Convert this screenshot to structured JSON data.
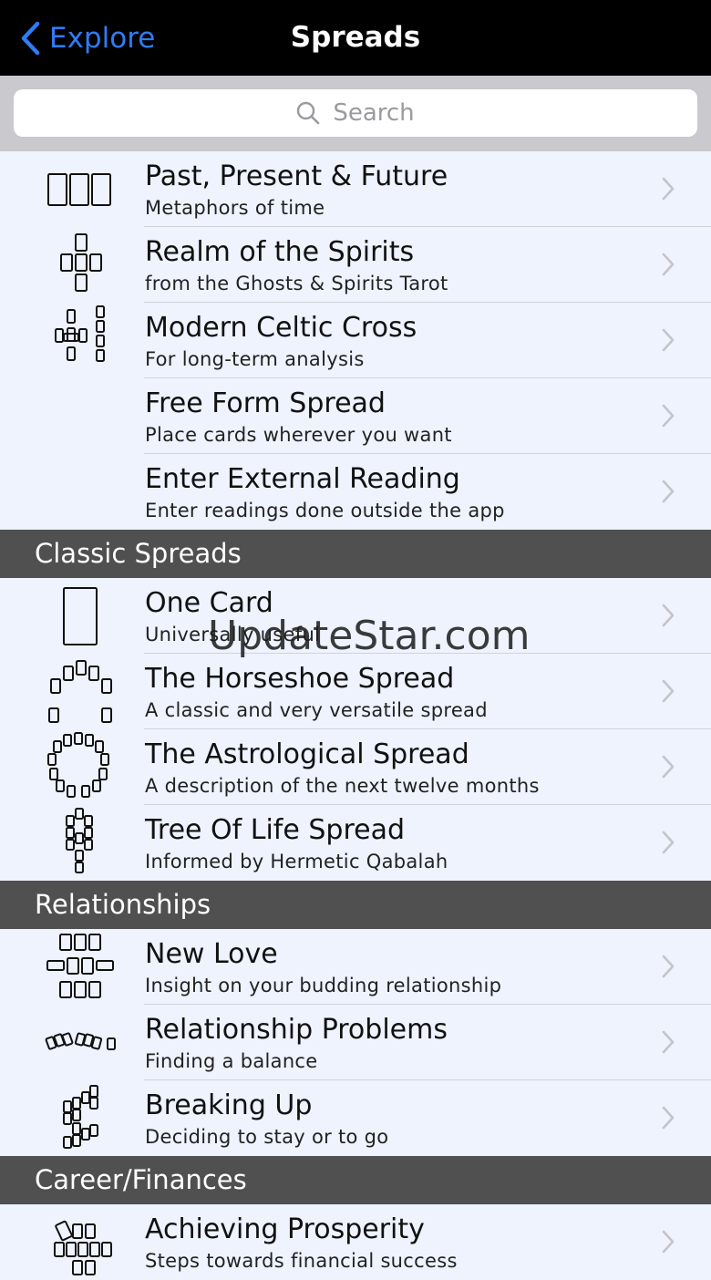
{
  "nav": {
    "back_label": "Explore",
    "title": "Spreads"
  },
  "search": {
    "placeholder": "Search"
  },
  "sections": [
    {
      "header": "",
      "rows": [
        {
          "title": "Past, Present & Future",
          "subtitle": "Metaphors of time",
          "icon": "three-card-spread-icon"
        },
        {
          "title": "Realm of the Spirits",
          "subtitle": "from the Ghosts & Spirits Tarot",
          "icon": "cross-spread-icon"
        },
        {
          "title": "Modern Celtic Cross",
          "subtitle": "For long-term analysis",
          "icon": "celtic-cross-icon"
        },
        {
          "title": "Free Form Spread",
          "subtitle": "Place cards wherever you want",
          "icon": ""
        },
        {
          "title": "Enter External Reading",
          "subtitle": "Enter readings done outside the app",
          "icon": ""
        }
      ]
    },
    {
      "header": "Classic Spreads",
      "rows": [
        {
          "title": "One Card",
          "subtitle": "Universally useful",
          "icon": "one-card-icon"
        },
        {
          "title": "The Horseshoe Spread",
          "subtitle": "A classic and very versatile spread",
          "icon": "horseshoe-spread-icon"
        },
        {
          "title": "The Astrological Spread",
          "subtitle": "A description of the next twelve months",
          "icon": "astrological-spread-icon"
        },
        {
          "title": "Tree Of Life Spread",
          "subtitle": "Informed by Hermetic Qabalah",
          "icon": "tree-of-life-icon"
        }
      ]
    },
    {
      "header": "Relationships",
      "rows": [
        {
          "title": "New Love",
          "subtitle": "Insight on your budding relationship",
          "icon": "new-love-spread-icon"
        },
        {
          "title": "Relationship Problems",
          "subtitle": "Finding a balance",
          "icon": "relationship-problems-icon"
        },
        {
          "title": "Breaking Up",
          "subtitle": "Deciding to stay or to go",
          "icon": "breaking-up-spread-icon"
        }
      ]
    },
    {
      "header": "Career/Finances",
      "rows": [
        {
          "title": "Achieving Prosperity",
          "subtitle": "Steps towards financial success",
          "icon": "prosperity-spread-icon"
        }
      ]
    }
  ],
  "watermark": "UpdateStar.com"
}
